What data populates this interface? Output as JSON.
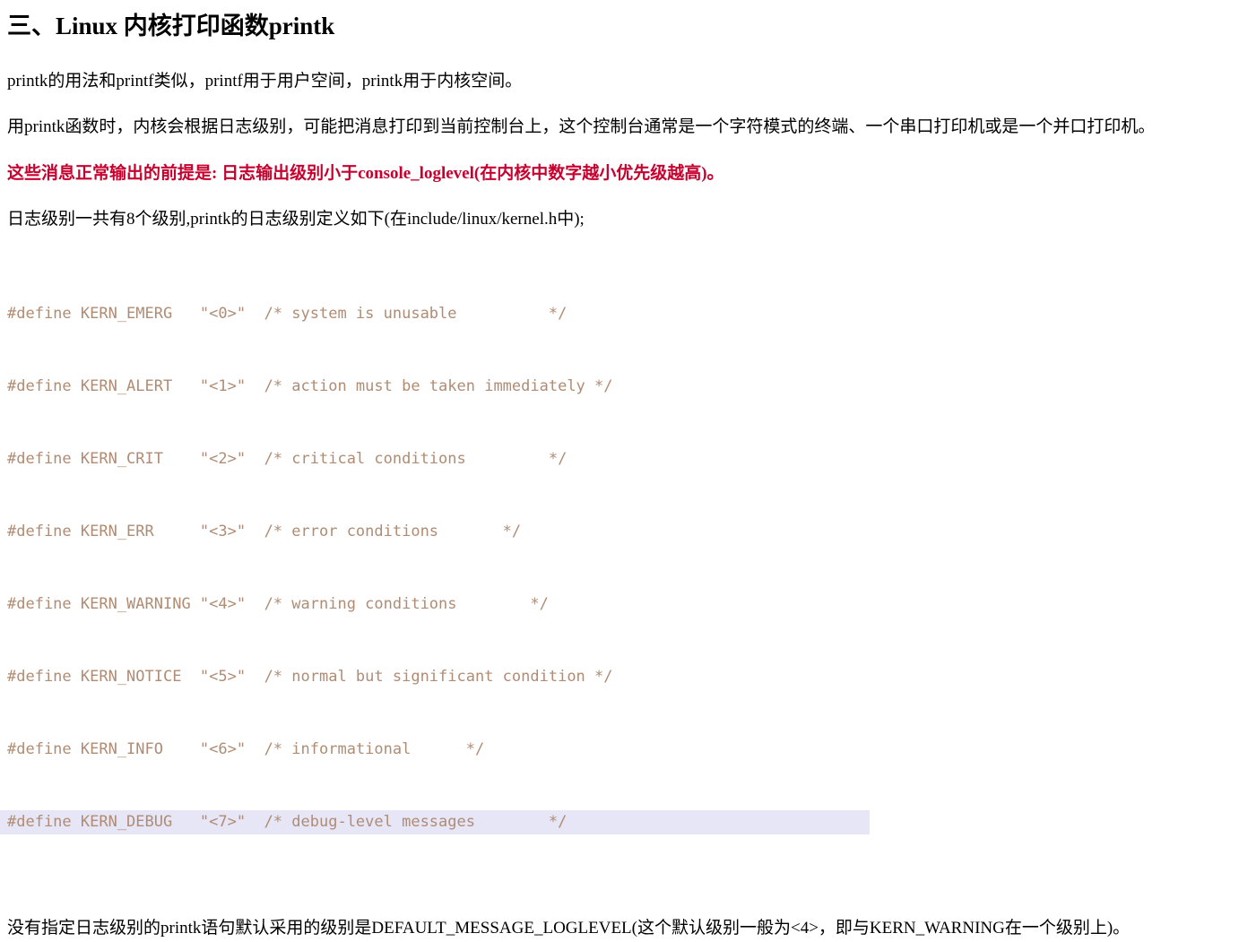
{
  "document": {
    "title": "三、Linux 内核打印函数printk",
    "paragraphs": {
      "intro": "printk的用法和printf类似，printf用于用户空间，printk用于内核空间。",
      "console": "用printk函数时，内核会根据日志级别，可能把消息打印到当前控制台上，这个控制台通常是一个字符模式的终端、一个串口打印机或是一个并口打印机。",
      "warning": "这些消息正常输出的前提是: 日志输出级别小于console_loglevel(在内核中数字越小优先级越高)。",
      "levels_intro": "日志级别一共有8个级别,printk的日志级别定义如下(在include/linux/kernel.h中);",
      "default_level": "没有指定日志级别的printk语句默认采用的级别是DEFAULT_MESSAGE_LOGLEVEL(这个默认级别一般为<4>，即与KERN_WARNING在一个级别上)。"
    },
    "code_block": {
      "lines": [
        "#define KERN_EMERG   \"<0>\"  /* system is unusable          */",
        "#define KERN_ALERT   \"<1>\"  /* action must be taken immediately */",
        "#define KERN_CRIT    \"<2>\"  /* critical conditions         */",
        "#define KERN_ERR     \"<3>\"  /* error conditions       */",
        "#define KERN_WARNING \"<4>\"  /* warning conditions        */",
        "#define KERN_NOTICE  \"<5>\"  /* normal but significant condition */",
        "#define KERN_INFO    \"<6>\"  /* informational      */",
        "#define KERN_DEBUG   \"<7>\"  /* debug-level messages        */"
      ],
      "highlighted_line_index": 7
    },
    "colors": {
      "code_text": "#b08c74",
      "warning_text": "#c7002e",
      "highlight_background": "#e6e6f7",
      "body_text": "#000000",
      "page_background": "#ffffff"
    }
  }
}
